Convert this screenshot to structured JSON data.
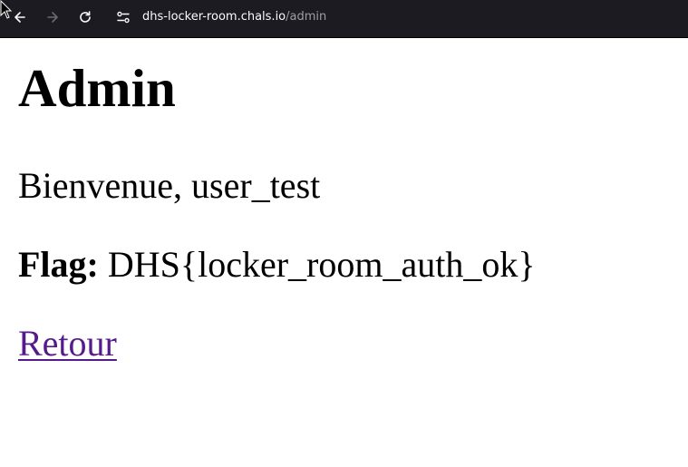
{
  "browser": {
    "url_host": "dhs-locker-room.chals.io",
    "url_path": "/admin",
    "icons": {
      "back": "arrow-left-icon",
      "forward": "arrow-right-icon",
      "reload": "reload-icon",
      "site_info": "site-settings-icon"
    },
    "colors": {
      "toolbar_bg": "#1c1b22",
      "url_host": "#fbfbfe",
      "url_path": "#9e9ea6"
    }
  },
  "page": {
    "title": "Admin",
    "welcome": "Bienvenue, user_test",
    "flag_label": "Flag:",
    "flag_value": "DHS{locker_room_auth_ok}",
    "back_link": "Retour",
    "colors": {
      "link": "#551a8b",
      "text": "#000000",
      "background": "#ffffff"
    }
  }
}
